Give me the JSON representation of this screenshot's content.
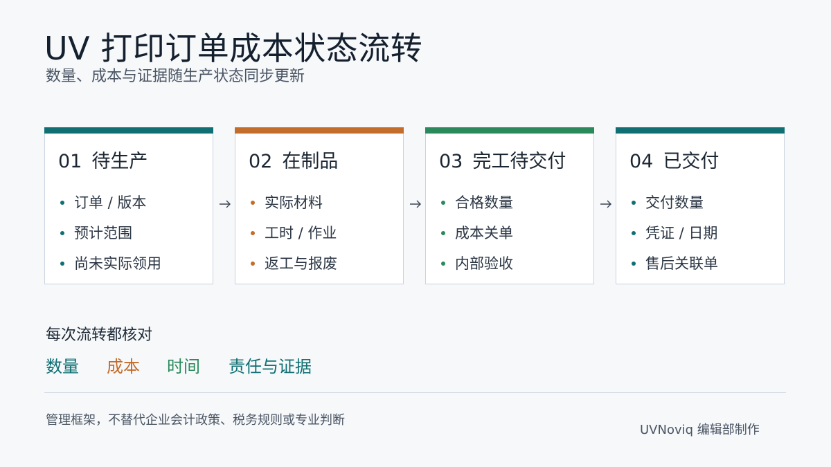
{
  "title": "UV 打印订单成本状态流转",
  "subtitle": "数量、成本与证据随生产状态同步更新",
  "colors": {
    "teal": "#0f6f73",
    "orange": "#c46c2a",
    "green": "#2a8a5c"
  },
  "stages": [
    {
      "number": "01",
      "name": "待生产",
      "color": "#0f6f73",
      "items": [
        "订单 / 版本",
        "预计范围",
        "尚未实际领用"
      ]
    },
    {
      "number": "02",
      "name": "在制品",
      "color": "#c46c2a",
      "items": [
        "实际材料",
        "工时 / 作业",
        "返工与报废"
      ]
    },
    {
      "number": "03",
      "name": "完工待交付",
      "color": "#2a8a5c",
      "items": [
        "合格数量",
        "成本关单",
        "内部验收"
      ]
    },
    {
      "number": "04",
      "name": "已交付",
      "color": "#0f6f73",
      "items": [
        "交付数量",
        "凭证 / 日期",
        "售后关联单"
      ]
    }
  ],
  "check": {
    "title": "每次流转都核对",
    "items": [
      {
        "label": "数量",
        "color": "#0f6f73"
      },
      {
        "label": "成本",
        "color": "#c46c2a"
      },
      {
        "label": "时间",
        "color": "#2a8a5c"
      },
      {
        "label": "责任与证据",
        "color": "#0f6f73"
      }
    ]
  },
  "footer": {
    "disclaimer": "管理框架，不替代企业会计政策、税务规则或专业判断",
    "brand": "UVNoviq 编辑部制作"
  }
}
